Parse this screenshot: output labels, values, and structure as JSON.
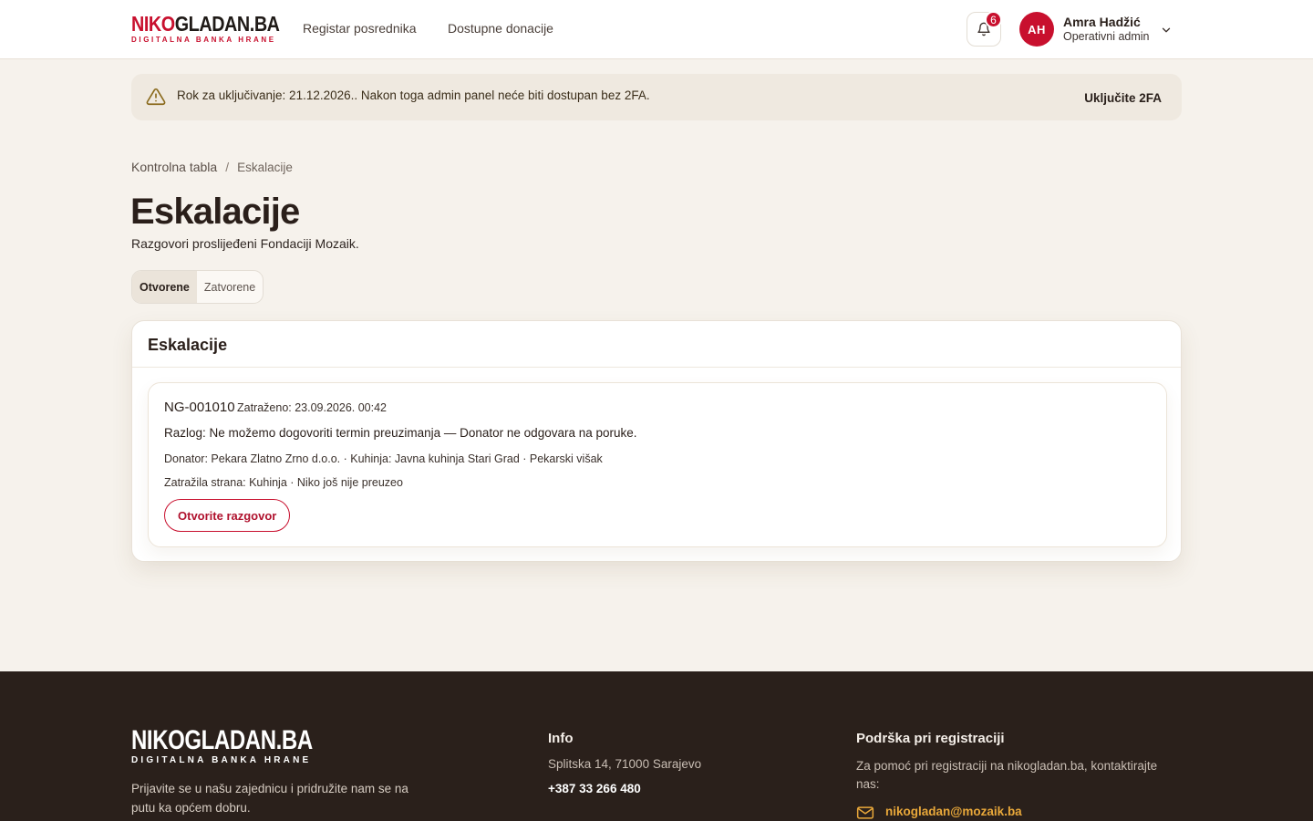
{
  "header": {
    "logo_word_red": "NIKO",
    "logo_word_dark": "GLADAN.BA",
    "logo_tagline": "DIGITALNA BANKA HRANE",
    "nav": [
      {
        "label": "Registar posrednika"
      },
      {
        "label": "Dostupne donacije"
      }
    ],
    "notifications_count": "6",
    "user": {
      "initials": "AH",
      "name": "Amra Hadžić",
      "role": "Operativni admin"
    }
  },
  "alert": {
    "text": "Rok za uključivanje: 21.12.2026.. Nakon toga admin panel neće biti dostupan bez 2FA.",
    "action_label": "Uključite 2FA"
  },
  "breadcrumb": {
    "home": "Kontrolna tabla",
    "separator": "/",
    "current": "Eskalacije"
  },
  "page": {
    "title": "Eskalacije",
    "subtitle": "Razgovori proslijeđeni Fondaciji Mozaik."
  },
  "tabs": [
    {
      "label": "Otvorene",
      "active": true
    },
    {
      "label": "Zatvorene",
      "active": false
    }
  ],
  "card": {
    "title": "Eskalacije",
    "items": [
      {
        "id": "NG-001010",
        "requested": "Zatraženo: 23.09.2026. 00:42",
        "reason": "Razlog: Ne možemo dogovoriti termin preuzimanja — Donator ne odgovara na poruke.",
        "donor_line": "Donator: Pekara Zlatno Zrno d.o.o. · Kuhinja: Javna kuhinja Stari Grad · Pekarski višak",
        "party_line": "Zatražila strana: Kuhinja · Niko još nije preuzeo",
        "button_label": "Otvorite razgovor"
      }
    ]
  },
  "footer": {
    "logo_word": "NIKOGLADAN.BA",
    "logo_tagline": "DIGITALNA BANKA HRANE",
    "about": "Prijavite se u našu zajednicu i pridružite nam se na putu ka općem dobru.",
    "info_title": "Info",
    "address": "Splitska 14, 71000 Sarajevo",
    "phone": "+387 33 266 480",
    "support_title": "Podrška pri registraciji",
    "support_text": "Za pomoć pri registraciji na nikogladan.ba, kontaktirajte nas:",
    "email": "nikogladan@mozaik.ba"
  },
  "colors": {
    "brand_red": "#c8102e",
    "page_bg": "#f6f2ec",
    "footer_bg": "#2a201b",
    "email_accent": "#e9a83a",
    "warning": "#8a6a1c"
  },
  "icons": [
    "bell-icon",
    "chevron-down-icon",
    "warning-icon",
    "mail-icon"
  ]
}
